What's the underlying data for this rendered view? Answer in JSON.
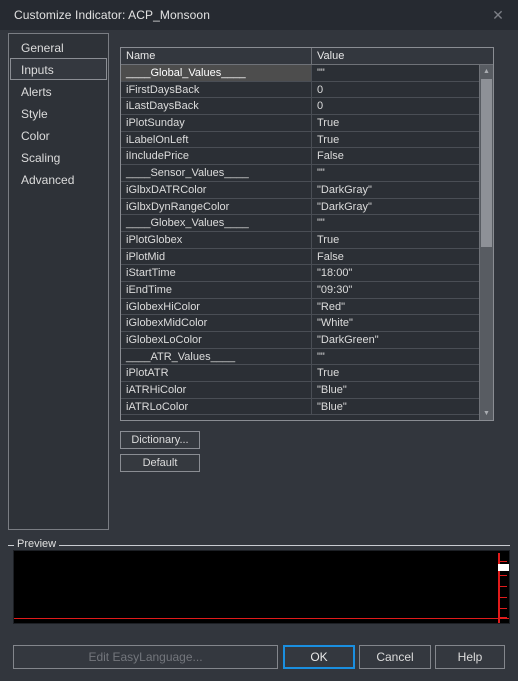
{
  "window": {
    "title": "Customize Indicator: ACP_Monsoon",
    "close_icon": "close-icon",
    "close_glyph": "✕"
  },
  "tabs": [
    {
      "label": "General",
      "selected": false
    },
    {
      "label": "Inputs",
      "selected": true
    },
    {
      "label": "Alerts",
      "selected": false
    },
    {
      "label": "Style",
      "selected": false
    },
    {
      "label": "Color",
      "selected": false
    },
    {
      "label": "Scaling",
      "selected": false
    },
    {
      "label": "Advanced",
      "selected": false
    }
  ],
  "grid": {
    "columns": [
      "Name",
      "Value"
    ],
    "rows": [
      {
        "name": "____Global_Values____",
        "value": "\"\"",
        "selected": true
      },
      {
        "name": "iFirstDaysBack",
        "value": "0",
        "selected": false
      },
      {
        "name": "iLastDaysBack",
        "value": "0",
        "selected": false
      },
      {
        "name": "iPlotSunday",
        "value": "True",
        "selected": false
      },
      {
        "name": "iLabelOnLeft",
        "value": "True",
        "selected": false
      },
      {
        "name": "iIncludePrice",
        "value": "False",
        "selected": false
      },
      {
        "name": "____Sensor_Values____",
        "value": "\"\"",
        "selected": false
      },
      {
        "name": "iGlbxDATRColor",
        "value": "\"DarkGray\"",
        "selected": false
      },
      {
        "name": "iGlbxDynRangeColor",
        "value": "\"DarkGray\"",
        "selected": false
      },
      {
        "name": "____Globex_Values____",
        "value": "\"\"",
        "selected": false
      },
      {
        "name": "iPlotGlobex",
        "value": "True",
        "selected": false
      },
      {
        "name": "iPlotMid",
        "value": "False",
        "selected": false
      },
      {
        "name": "iStartTime",
        "value": "\"18:00\"",
        "selected": false
      },
      {
        "name": "iEndTime",
        "value": "\"09:30\"",
        "selected": false
      },
      {
        "name": "iGlobexHiColor",
        "value": "\"Red\"",
        "selected": false
      },
      {
        "name": "iGlobexMidColor",
        "value": "\"White\"",
        "selected": false
      },
      {
        "name": "iGlobexLoColor",
        "value": "\"DarkGreen\"",
        "selected": false
      },
      {
        "name": "____ATR_Values____",
        "value": "\"\"",
        "selected": false
      },
      {
        "name": "iPlotATR",
        "value": "True",
        "selected": false
      },
      {
        "name": "iATRHiColor",
        "value": "\"Blue\"",
        "selected": false
      },
      {
        "name": "iATRLoColor",
        "value": "\"Blue\"",
        "selected": false
      }
    ],
    "scrollbar": {
      "up_glyph": "▲",
      "down_glyph": "▼"
    }
  },
  "side_buttons": {
    "dictionary_label": "Dictionary...",
    "default_label": "Default"
  },
  "preview": {
    "legend": "Preview",
    "axis_color": "#e01b1b",
    "background": "#000000",
    "marker_color": "#ffffff"
  },
  "footer": {
    "edit_label": "Edit EasyLanguage...",
    "ok_label": "OK",
    "cancel_label": "Cancel",
    "help_label": "Help",
    "focus_color": "#1a8fe0"
  }
}
